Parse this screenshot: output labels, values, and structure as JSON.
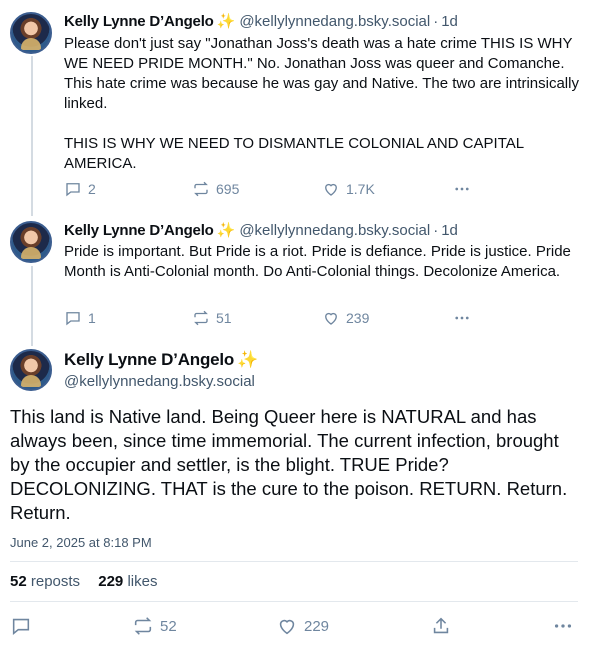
{
  "posts": [
    {
      "author": "Kelly Lynne D’Angelo",
      "sparkle": "✨",
      "handle": "@kellylynnedang.bsky.social",
      "separator": "·",
      "time": "1d",
      "paragraphs": [
        "Please don't just say \"Jonathan Joss's death was a hate crime THIS IS WHY WE NEED PRIDE MONTH.\" No. Jonathan Joss was queer and Comanche. This hate crime was because he was gay and Native. The two are intrinsically linked.",
        "THIS IS WHY WE NEED TO DISMANTLE COLONIAL AND CAPITAL AMERICA."
      ],
      "replies": "2",
      "reposts": "695",
      "likes": "1.7K"
    },
    {
      "author": "Kelly Lynne D’Angelo",
      "sparkle": "✨",
      "handle": "@kellylynnedang.bsky.social",
      "separator": "·",
      "time": "1d",
      "paragraphs": [
        "Pride is important. But Pride is a riot. Pride is defiance. Pride is justice. Pride Month is Anti-Colonial month. Do Anti-Colonial things. Decolonize America."
      ],
      "replies": "1",
      "reposts": "51",
      "likes": "239"
    }
  ],
  "main_post": {
    "author": "Kelly Lynne D’Angelo",
    "sparkle": "✨",
    "handle": "@kellylynnedang.bsky.social",
    "text": "This land is Native land. Being Queer here is NATURAL and has always been, since time immemorial. The current infection, brought by the occupier and settler, is the blight. TRUE Pride? DECOLONIZING. THAT is the cure to the poison. RETURN. Return. Return.",
    "date": "June 2, 2025 at 8:18 PM",
    "reposts_count": "52",
    "reposts_label": "reposts",
    "likes_count": "229",
    "likes_label": "likes",
    "action_reposts": "52",
    "action_likes": "229"
  },
  "colors": {
    "text": "#0b0f14",
    "muted": "#42576c",
    "icon": "#6f869f",
    "divider": "#e3e8ed",
    "thread_line": "#d4dbe2",
    "sparkle": "#f0c419"
  },
  "icons": [
    "reply-icon",
    "repost-icon",
    "like-icon",
    "more-icon",
    "share-icon"
  ]
}
